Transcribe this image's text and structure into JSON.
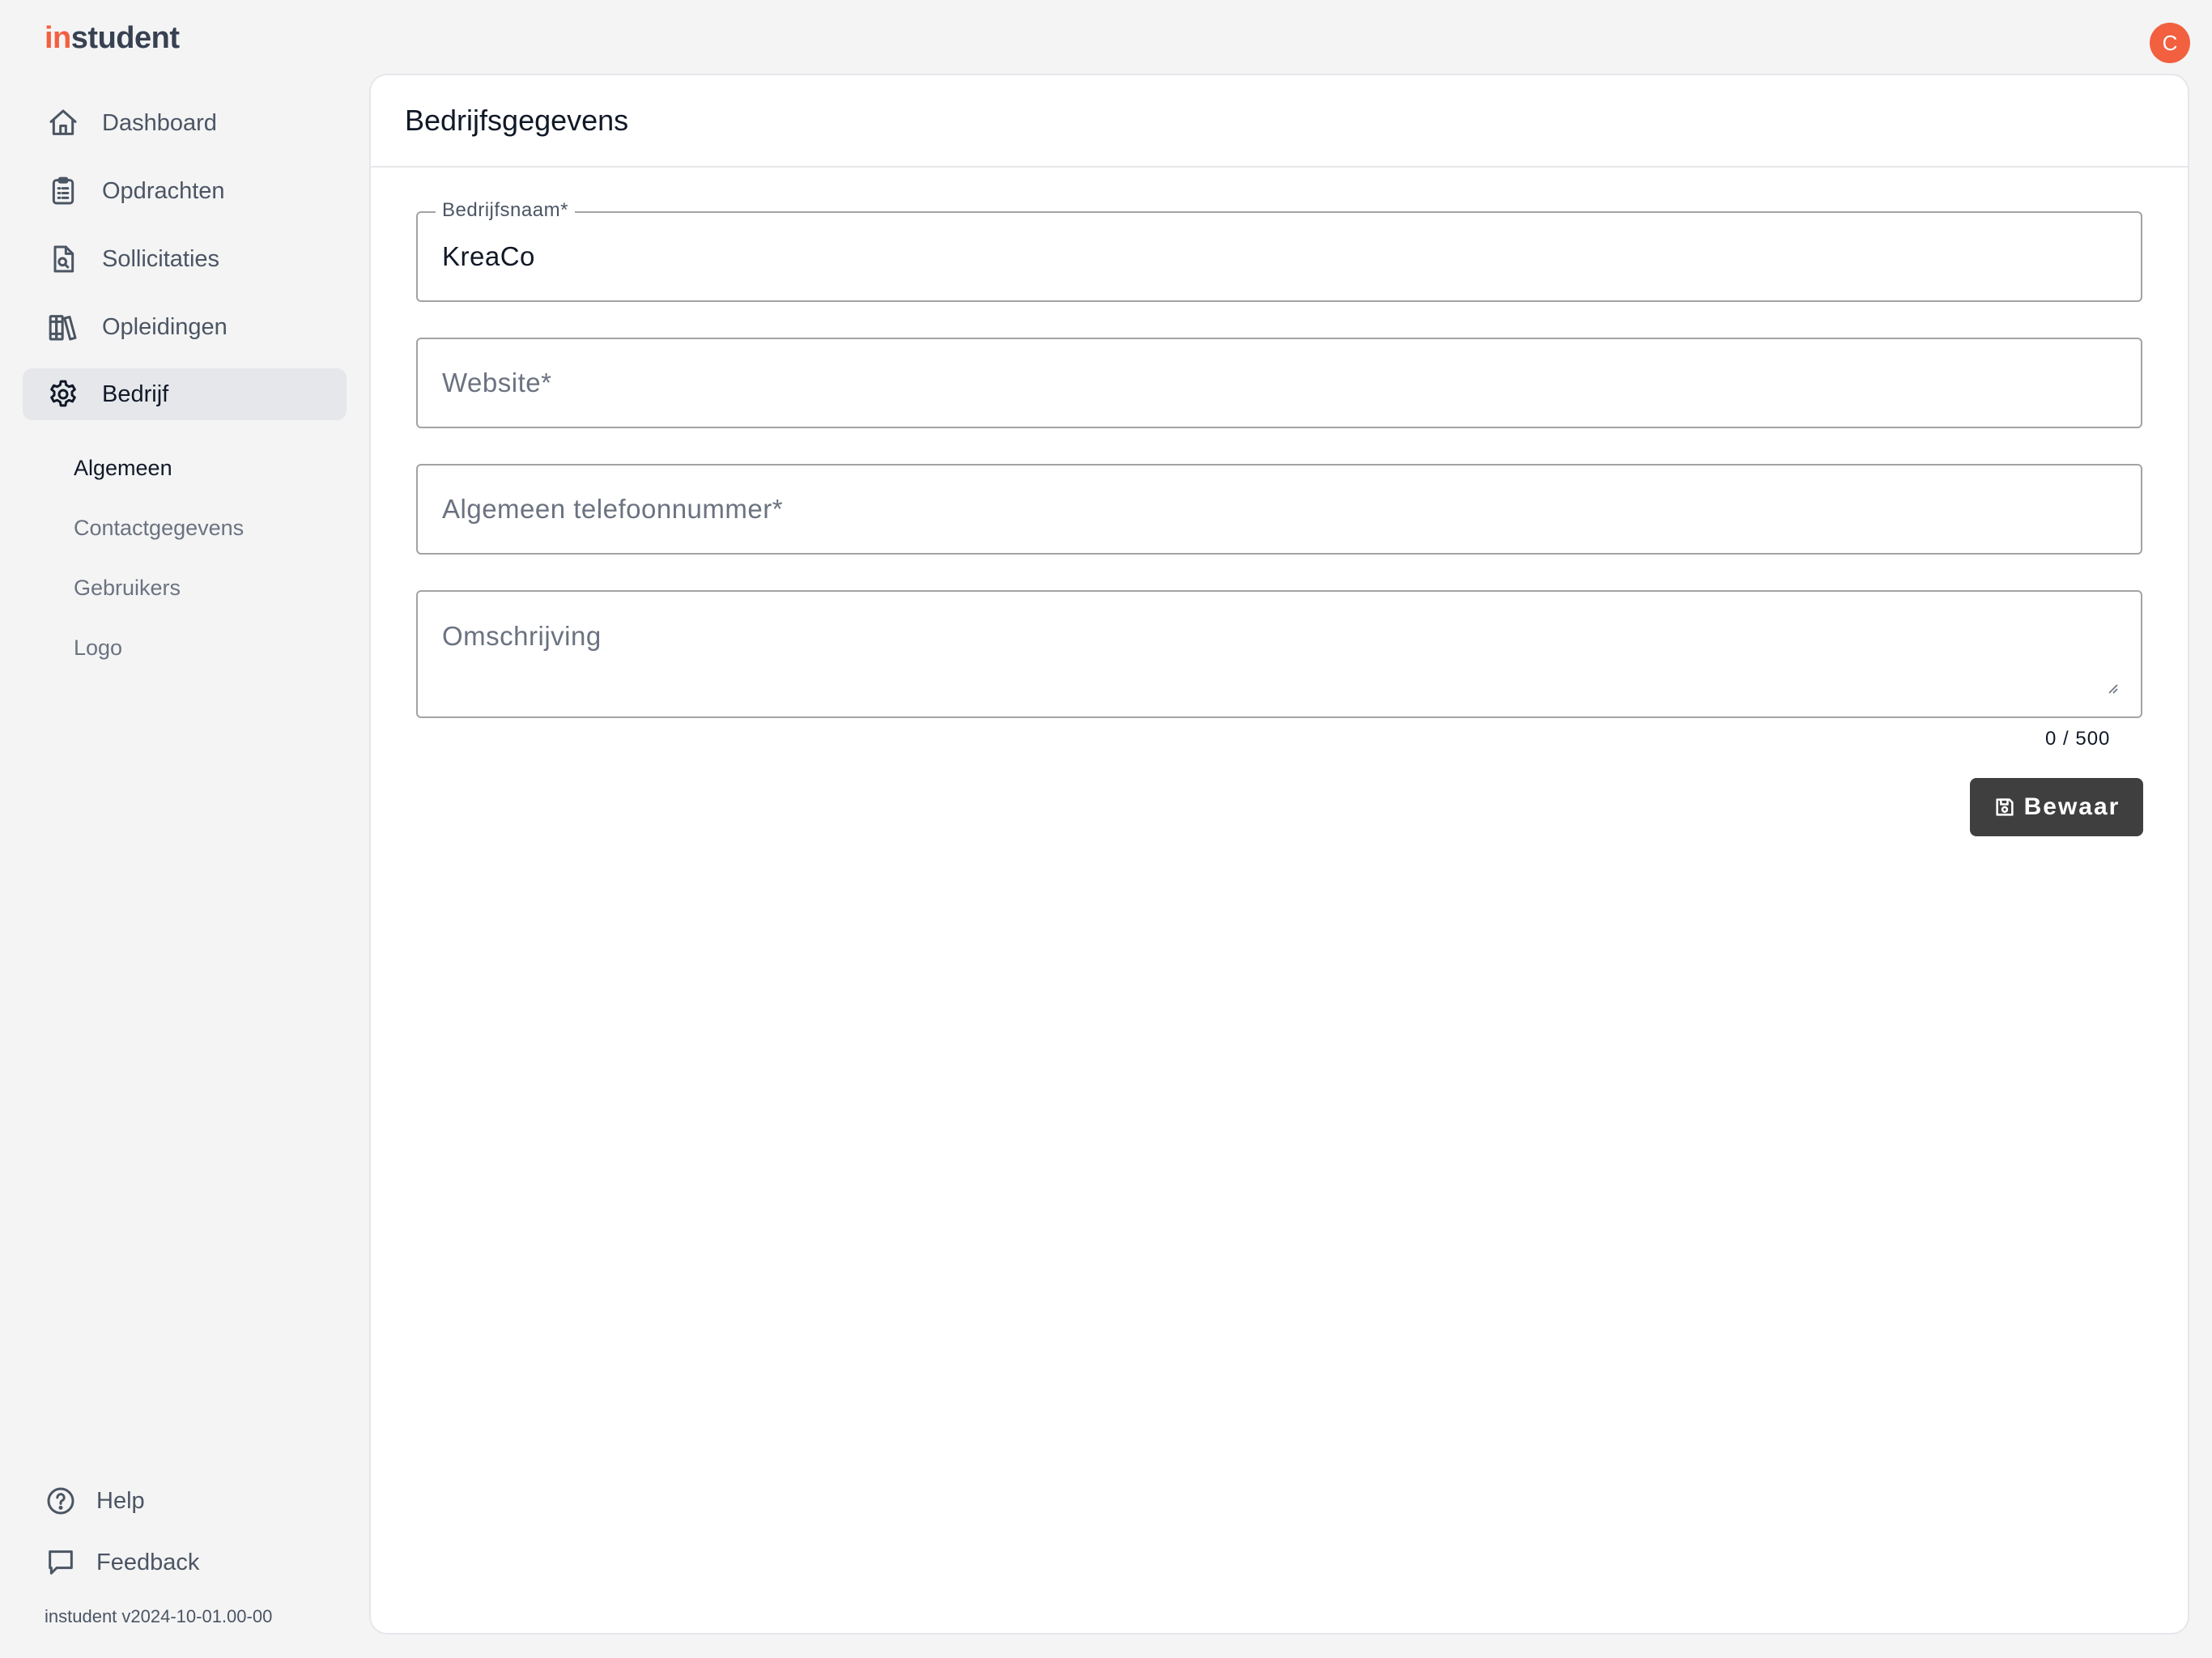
{
  "brand": {
    "prefix": "in",
    "rest": "student"
  },
  "user": {
    "initial": "C"
  },
  "sidebar": {
    "items": [
      {
        "label": "Dashboard",
        "icon": "home-icon"
      },
      {
        "label": "Opdrachten",
        "icon": "clipboard-list-icon"
      },
      {
        "label": "Sollicitaties",
        "icon": "document-search-icon"
      },
      {
        "label": "Opleidingen",
        "icon": "books-icon"
      },
      {
        "label": "Bedrijf",
        "icon": "gear-icon",
        "active": true
      }
    ],
    "subitems": [
      {
        "label": "Algemeen",
        "active": true
      },
      {
        "label": "Contactgegevens"
      },
      {
        "label": "Gebruikers"
      },
      {
        "label": "Logo"
      }
    ],
    "bottom": [
      {
        "label": "Help",
        "icon": "help-circle-icon"
      },
      {
        "label": "Feedback",
        "icon": "chat-bubble-icon"
      }
    ],
    "version": "instudent v2024-10-01.00-00"
  },
  "main": {
    "title": "Bedrijfsgegevens",
    "fields": {
      "company_name": {
        "label": "Bedrijfsnaam*",
        "value": "KreaCo"
      },
      "website": {
        "placeholder": "Website*"
      },
      "phone": {
        "placeholder": "Algemeen telefoonnummer*"
      },
      "description": {
        "placeholder": "Omschrijving"
      }
    },
    "counter": "0 / 500",
    "save_label": "Bewaar"
  },
  "colors": {
    "accent": "#f2603f",
    "button": "#3f3f3f",
    "active_nav": "#e5e7eb"
  }
}
